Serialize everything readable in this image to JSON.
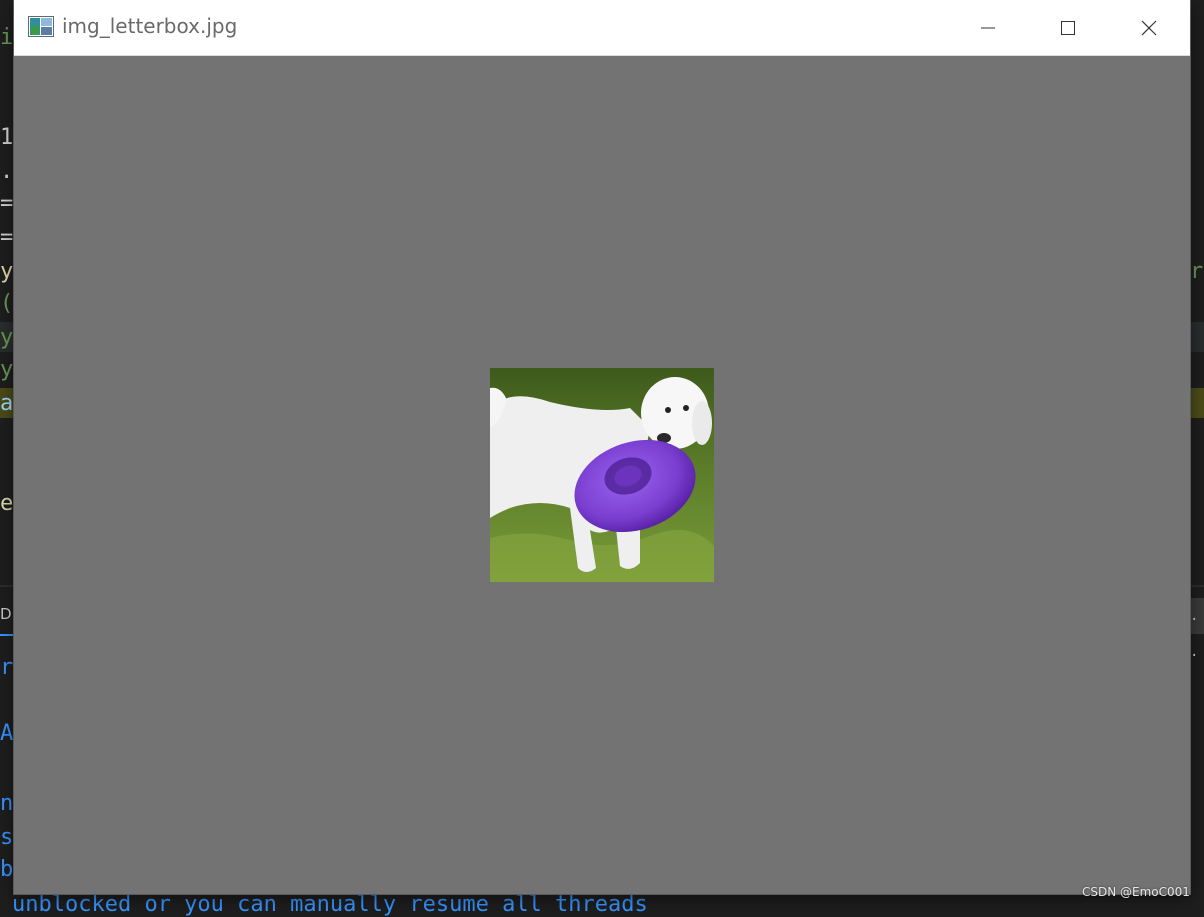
{
  "window": {
    "title": "img_letterbox.jpg",
    "canvas_color": "#737373",
    "buttons": {
      "minimize": "minimize-icon",
      "maximize": "maximize-icon",
      "close": "close-icon"
    }
  },
  "image": {
    "subject": "white dog holding purple frisbee",
    "frisbee_color": "#7a3fd0"
  },
  "background_ide": {
    "code_glyphs": [
      "i",
      "1",
      ".",
      "=",
      "=",
      "y",
      "(",
      "y",
      "y",
      "a",
      "e"
    ],
    "right_glyph": "r",
    "panel_tab": "D",
    "panel_right_glyph": ". .",
    "terminal_glyphs": [
      "r",
      "A",
      "n",
      "s",
      "b"
    ],
    "terminal_bottom": "unblocked or you can manually resume all threads"
  },
  "watermark": "CSDN @EmoC001",
  "colors": {
    "accent": "#3794ff",
    "ide_bg": "#1e1e1e",
    "highlight": "#4b4b18"
  }
}
